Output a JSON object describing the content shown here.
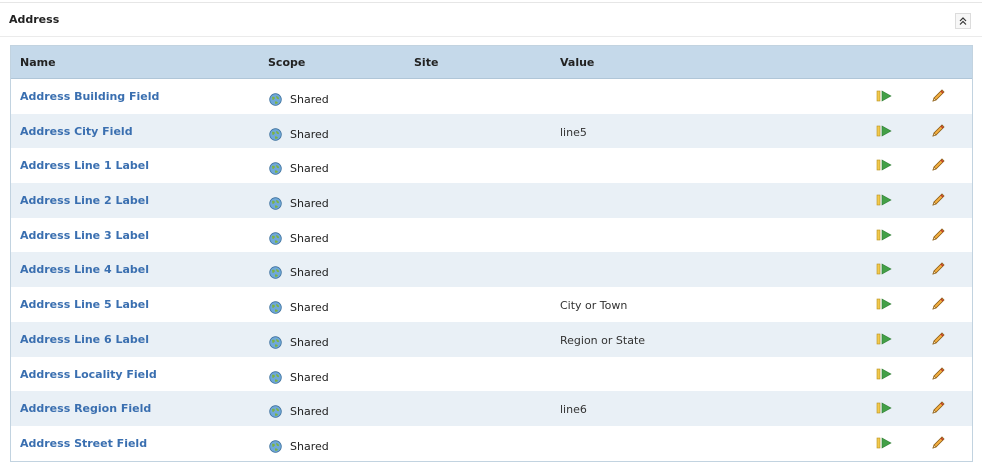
{
  "panel": {
    "title": "Address"
  },
  "table": {
    "headers": {
      "name": "Name",
      "scope": "Scope",
      "site": "Site",
      "value": "Value"
    },
    "rows": [
      {
        "name": "Address Building Field",
        "scope": "Shared",
        "site": "",
        "value": ""
      },
      {
        "name": "Address City Field",
        "scope": "Shared",
        "site": "",
        "value": "line5"
      },
      {
        "name": "Address Line 1 Label",
        "scope": "Shared",
        "site": "",
        "value": ""
      },
      {
        "name": "Address Line 2 Label",
        "scope": "Shared",
        "site": "",
        "value": ""
      },
      {
        "name": "Address Line 3 Label",
        "scope": "Shared",
        "site": "",
        "value": ""
      },
      {
        "name": "Address Line 4 Label",
        "scope": "Shared",
        "site": "",
        "value": ""
      },
      {
        "name": "Address Line 5 Label",
        "scope": "Shared",
        "site": "",
        "value": "City or Town"
      },
      {
        "name": "Address Line 6 Label",
        "scope": "Shared",
        "site": "",
        "value": "Region or State"
      },
      {
        "name": "Address Locality Field",
        "scope": "Shared",
        "site": "",
        "value": ""
      },
      {
        "name": "Address Region Field",
        "scope": "Shared",
        "site": "",
        "value": "line6"
      },
      {
        "name": "Address Street Field",
        "scope": "Shared",
        "site": "",
        "value": ""
      }
    ]
  },
  "icons": {
    "collapse": "double-chevron-up-icon",
    "scope": "globe-icon",
    "run": "run-icon",
    "edit": "pencil-icon"
  },
  "colors": {
    "header_bg": "#c5d9ea",
    "alt_row_bg": "#e9f0f6",
    "link": "#3a6fb0"
  }
}
